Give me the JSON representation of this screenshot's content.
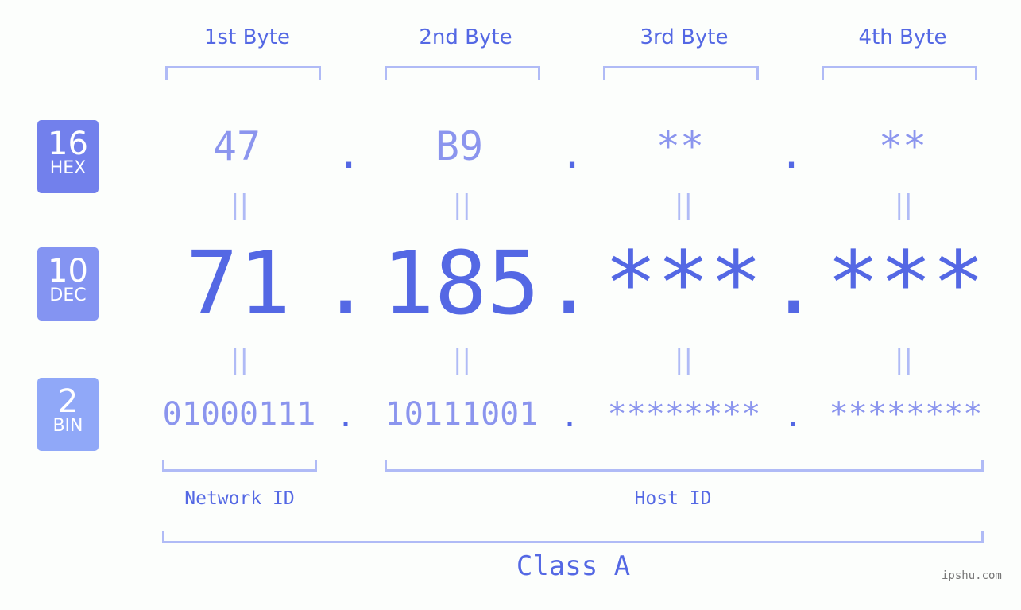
{
  "ip": {
    "hex": [
      "47",
      "B9",
      "**",
      "**"
    ],
    "dec": [
      "71",
      "185",
      "***",
      "***"
    ],
    "bin": [
      "01000111",
      "10111001",
      "********",
      "********"
    ],
    "separator": "."
  },
  "byte_headers": [
    "1st Byte",
    "2nd Byte",
    "3rd Byte",
    "4th Byte"
  ],
  "bases": [
    {
      "num": "16",
      "label": "HEX",
      "color": "#7280ec"
    },
    {
      "num": "10",
      "label": "DEC",
      "color": "#8494f2"
    },
    {
      "num": "2",
      "label": "BIN",
      "color": "#90a8f8"
    }
  ],
  "equals_glyph": "||",
  "network_id_label": "Network ID",
  "host_id_label": "Host ID",
  "class_label": "Class A",
  "watermark": "ipshu.com",
  "colors": {
    "accent": "#5468e4",
    "light": "#8b95ee",
    "bracket": "#b0bbf6"
  }
}
